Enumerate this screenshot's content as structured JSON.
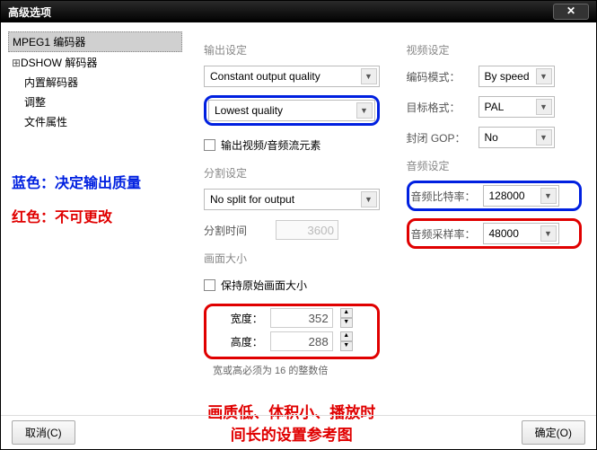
{
  "window": {
    "title": "高级选项"
  },
  "sidebar": {
    "items": [
      {
        "label": "MPEG1 编码器"
      },
      {
        "label": "DSHOW 解码器"
      },
      {
        "label": "内置解码器"
      },
      {
        "label": "调整"
      },
      {
        "label": "文件属性"
      }
    ]
  },
  "notes": {
    "blue": "蓝色：决定输出质量",
    "red": "红色：不可更改",
    "bottom": "画质低、体积小、播放时间长的设置参考图"
  },
  "output": {
    "section": "输出设定",
    "mode": "Constant output quality",
    "quality": "Lowest quality",
    "streamcb_label": "输出视频/音频流元素"
  },
  "split": {
    "section": "分割设定",
    "mode": "No split for output",
    "time_label": "分割时间",
    "time_value": "3600"
  },
  "size": {
    "section": "画面大小",
    "keep_label": "保持原始画面大小",
    "width_label": "宽度：",
    "width_value": "352",
    "height_label": "高度：",
    "height_value": "288",
    "hint": "宽或高必须为 16 的整数倍"
  },
  "video": {
    "section": "视频设定",
    "encode_label": "编码模式：",
    "encode_value": "By speed",
    "target_label": "目标格式：",
    "target_value": "PAL",
    "gop_label": "封闭 GOP：",
    "gop_value": "No"
  },
  "audio": {
    "section": "音频设定",
    "bitrate_label": "音频比特率：",
    "bitrate_value": "128000",
    "sample_label": "音频采样率：",
    "sample_value": "48000"
  },
  "footer": {
    "cancel": "取消(C)",
    "ok": "确定(O)"
  }
}
